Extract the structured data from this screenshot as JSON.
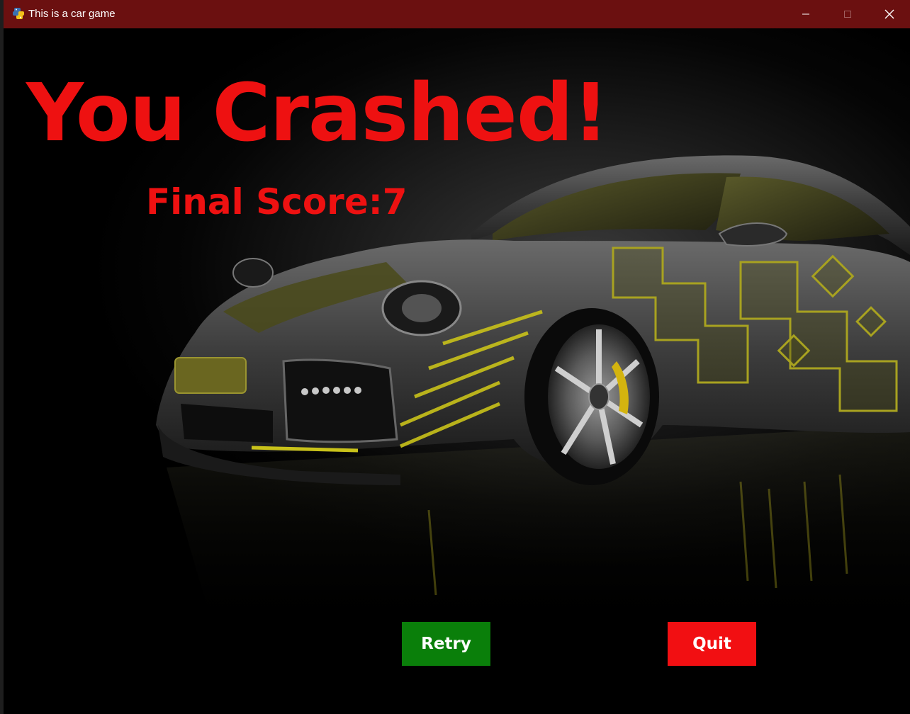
{
  "window": {
    "title": "This is a car game",
    "icon": "python-snake-icon",
    "controls": [
      "minimize-icon",
      "maximize-icon",
      "close-icon"
    ]
  },
  "game": {
    "headline": "You Crashed!",
    "score_text": "Final Score:7",
    "final_score": 7,
    "buttons": {
      "retry": "Retry",
      "quit": "Quit"
    }
  },
  "colors": {
    "titlebar": "#6b1010",
    "headline": "#ee1111",
    "retry_button": "#0a7f0a",
    "quit_button": "#f20f12",
    "car_accent": "#c9c21a"
  }
}
